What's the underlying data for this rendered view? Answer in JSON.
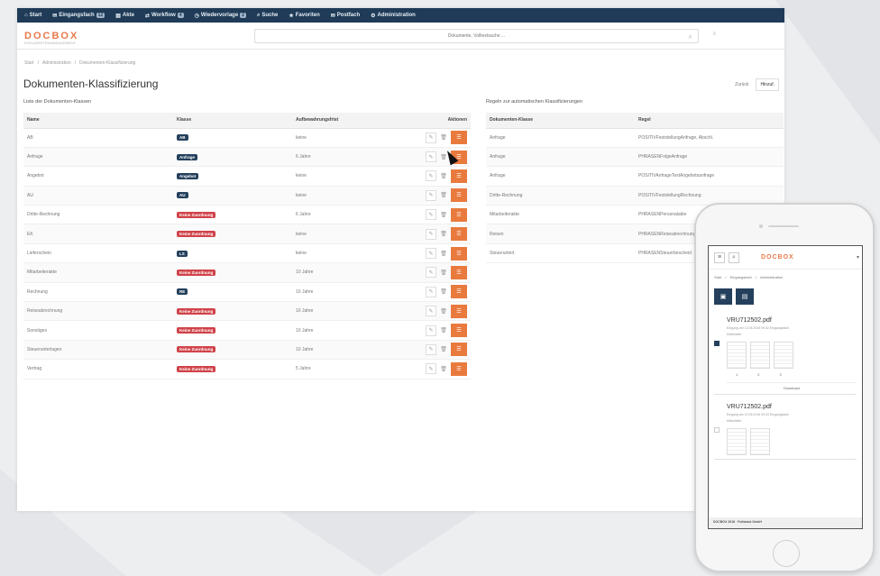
{
  "nav": [
    {
      "label": "Start",
      "icon": "home-icon",
      "badge": ""
    },
    {
      "label": "Eingangsfach",
      "icon": "inbox-icon",
      "badge": "12"
    },
    {
      "label": "Akte",
      "icon": "folder-icon",
      "badge": ""
    },
    {
      "label": "Workflow",
      "icon": "workflow-icon",
      "badge": "4"
    },
    {
      "label": "Wiedervorlage",
      "icon": "clock-icon",
      "badge": "2"
    },
    {
      "label": "Suche",
      "icon": "search-icon",
      "badge": ""
    },
    {
      "label": "Favoriten",
      "icon": "star-icon",
      "badge": ""
    },
    {
      "label": "Postfach",
      "icon": "mail-icon",
      "badge": ""
    },
    {
      "label": "Administration",
      "icon": "gear-icon",
      "badge": ""
    }
  ],
  "header": {
    "logo": "DOCBOX",
    "logo_sub": "DOKUMENTENMANAGEMENT",
    "search_placeholder": "Dokumente, Volltextsuche ...",
    "menu": "≡"
  },
  "breadcrumb": [
    "Start",
    "Administration",
    "Dokumenten-Klassifizierung"
  ],
  "page_title": "Dokumenten-Klassifizierung",
  "top_buttons": [
    "Zurück",
    "Hinzuf."
  ],
  "left_table": {
    "label": "Liste der Dokumenten-Klassen",
    "headers": [
      "Name",
      "Klasse",
      "Aufbewahrungsfrist",
      "Aktionen"
    ],
    "rows": [
      {
        "name": "AB",
        "klasse": "AB",
        "color": "navy",
        "frist": "keine"
      },
      {
        "name": "Anfrage",
        "klasse": "Anfrage",
        "color": "navy",
        "frist": "6 Jahre"
      },
      {
        "name": "Angebot",
        "klasse": "Angebot",
        "color": "navy",
        "frist": "keine"
      },
      {
        "name": "AU",
        "klasse": "AU",
        "color": "navy",
        "frist": "keine"
      },
      {
        "name": "Dritte-Rechnung",
        "klasse": "Keine Zuordnung",
        "color": "red",
        "frist": "6 Jahre"
      },
      {
        "name": "EK",
        "klasse": "Keine Zuordnung",
        "color": "red",
        "frist": "keine"
      },
      {
        "name": "Lieferschein",
        "klasse": "LS",
        "color": "navy",
        "frist": "keine"
      },
      {
        "name": "Mitarbeiterakte",
        "klasse": "Keine Zuordnung",
        "color": "red",
        "frist": "10 Jahre"
      },
      {
        "name": "Rechnung",
        "klasse": "RE",
        "color": "navy",
        "frist": "10 Jahre"
      },
      {
        "name": "Reiseabrechnung",
        "klasse": "Keine Zuordnung",
        "color": "red",
        "frist": "10 Jahre"
      },
      {
        "name": "Sonstiges",
        "klasse": "Keine Zuordnung",
        "color": "red",
        "frist": "10 Jahre"
      },
      {
        "name": "Steuerunterlagen",
        "klasse": "Keine Zuordnung",
        "color": "red",
        "frist": "10 Jahre"
      },
      {
        "name": "Vertrag",
        "klasse": "Keine Zuordnung",
        "color": "red",
        "frist": "5 Jahre"
      }
    ]
  },
  "right_table": {
    "label": "Regeln zur automatischen Klassifizierungen",
    "headers": [
      "Dokumenten-Klasse",
      "Regel"
    ],
    "rows": [
      {
        "klasse": "Anfrage",
        "regel": "POSITIVFeststellungAnfrage, Abschl."
      },
      {
        "klasse": "Anfrage",
        "regel": "PHRASENFolgeAnfrage"
      },
      {
        "klasse": "Anfrage",
        "regel": "POSITIVAnfrageTextAngebotsanfrage"
      },
      {
        "klasse": "Dritte-Rechnung",
        "regel": "POSITIVFeststellungRechnung"
      },
      {
        "klasse": "Mitarbeiterakte",
        "regel": "PHRASENPersonalakte"
      },
      {
        "klasse": "Reisen",
        "regel": "PHRASENReiseabrechnung"
      },
      {
        "klasse": "Steuerunterl.",
        "regel": "PHRASENSteuerbescheid"
      }
    ]
  },
  "colors": {
    "navy": "#24405c",
    "red": "#d04248",
    "orange": "#e97a3e",
    "topbar": "#1f3b57"
  },
  "phone": {
    "logo": "DOCBOX",
    "breadcrumb": [
      "Start",
      "Eingangsfach",
      "Administration"
    ],
    "cards": [
      {
        "file": "VRU712502.pdf",
        "meta": "Eingang am 12.05.2016 09:32 Eingangsfach",
        "user": "Mitarbeiter",
        "nums": [
          "1",
          "2",
          "3"
        ],
        "download": "Download"
      },
      {
        "file": "VRU712502.pdf",
        "meta": "Eingang am 12.05.2016 09:33 Eingangsfach",
        "user": "Mitarbeiter"
      }
    ],
    "footer": "DOCBOX 2016 · Fullstack GmbH"
  }
}
